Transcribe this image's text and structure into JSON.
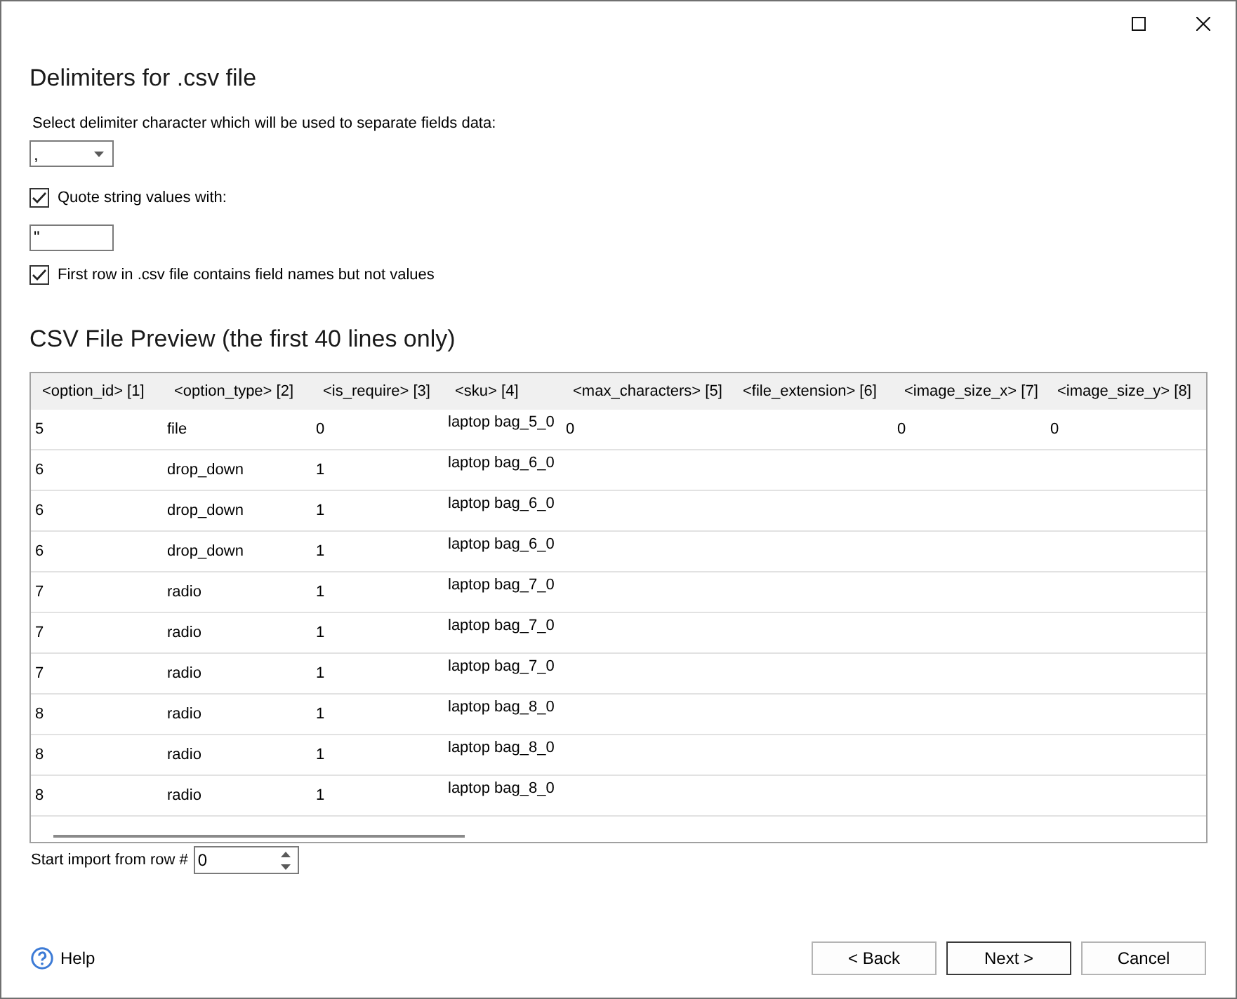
{
  "delimiters": {
    "heading": "Delimiters for .csv file",
    "prompt": "Select delimiter character which will be used to separate fields data:",
    "delimiter": {
      "value": ","
    },
    "quote_option": {
      "label": "Quote string values with:",
      "checked": true
    },
    "quote_char": {
      "value": "\""
    },
    "header_option": {
      "label": "First row in .csv file contains field names but not values",
      "checked": true
    }
  },
  "preview": {
    "heading": "CSV File Preview (the first 40 lines only)",
    "columns": [
      "<option_id> [1]",
      "<option_type> [2]",
      "<is_require> [3]",
      "<sku> [4]",
      "<max_characters> [5]",
      "<file_extension> [6]",
      "<image_size_x> [7]",
      "<image_size_y> [8]"
    ],
    "rows": [
      [
        "5",
        "file",
        "0",
        "laptop bag_5_0",
        "0",
        null,
        "0",
        "0"
      ],
      [
        "6",
        "drop_down",
        "1",
        "laptop bag_6_0"
      ],
      [
        "6",
        "drop_down",
        "1",
        "laptop bag_6_0"
      ],
      [
        "6",
        "drop_down",
        "1",
        "laptop bag_6_0"
      ],
      [
        "7",
        "radio",
        "1",
        "laptop bag_7_0"
      ],
      [
        "7",
        "radio",
        "1",
        "laptop bag_7_0"
      ],
      [
        "7",
        "radio",
        "1",
        "laptop bag_7_0"
      ],
      [
        "8",
        "radio",
        "1",
        "laptop bag_8_0"
      ],
      [
        "8",
        "radio",
        "1",
        "laptop bag_8_0"
      ],
      [
        "8",
        "radio",
        "1",
        "laptop bag_8_0"
      ]
    ]
  },
  "start_row": {
    "label": "Start import from row #",
    "value": "0"
  },
  "help": {
    "label": "Help"
  },
  "buttons": [
    {
      "label": "< Back",
      "default": false
    },
    {
      "label": "Next >",
      "default": true
    },
    {
      "label": "Cancel",
      "default": false
    }
  ]
}
